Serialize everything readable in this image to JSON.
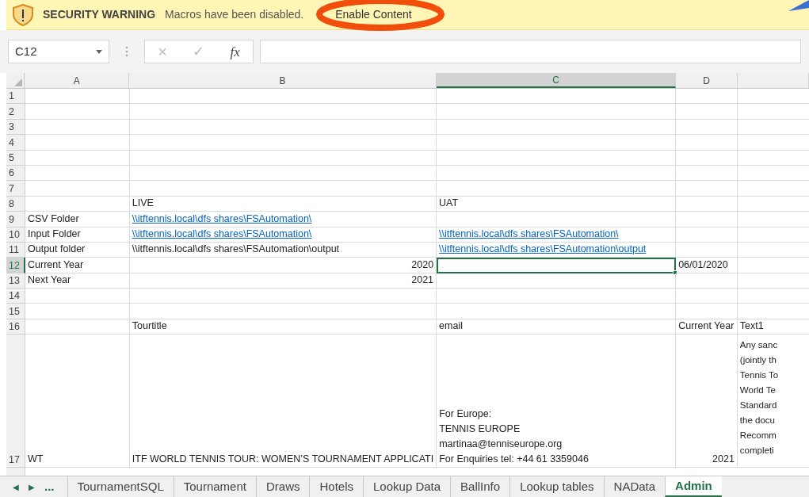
{
  "security_bar": {
    "title": "SECURITY WARNING",
    "message": "Macros have been disabled.",
    "button": "Enable Content"
  },
  "formula_bar": {
    "name_box": "C12",
    "buttons": [
      "×",
      "✓",
      "fx"
    ]
  },
  "columns": [
    {
      "label": "A",
      "selected": false
    },
    {
      "label": "B",
      "selected": false
    },
    {
      "label": "C",
      "selected": true
    },
    {
      "label": "D",
      "selected": false
    },
    {
      "selected": false
    }
  ],
  "rows": [
    {
      "number": "1",
      "selected": false,
      "cells": [
        null,
        null,
        null,
        null,
        null
      ]
    },
    {
      "number": "2",
      "selected": false,
      "cells": [
        null,
        null,
        null,
        null,
        null
      ]
    },
    {
      "number": "3",
      "selected": false,
      "cells": [
        null,
        null,
        null,
        null,
        null
      ]
    },
    {
      "number": "4",
      "selected": false,
      "cells": [
        null,
        null,
        null,
        null,
        null
      ]
    },
    {
      "number": "5",
      "selected": false,
      "cells": [
        null,
        null,
        null,
        null,
        null
      ]
    },
    {
      "number": "6",
      "selected": false,
      "cells": [
        null,
        null,
        null,
        null,
        null
      ]
    },
    {
      "number": "7",
      "selected": false,
      "cells": [
        null,
        null,
        null,
        null,
        null
      ]
    },
    {
      "number": "8",
      "selected": false,
      "cells": [
        null,
        {
          "kind": "text",
          "lines": [
            "LIVE"
          ]
        },
        {
          "kind": "text",
          "lines": [
            "UAT"
          ]
        },
        null,
        null
      ]
    },
    {
      "number": "9",
      "selected": false,
      "cells": [
        {
          "kind": "text",
          "lines": [
            "CSV Folder"
          ]
        },
        {
          "kind": "link",
          "lines": [
            "\\\\itftennis.local\\dfs shares\\FSAutomation\\"
          ]
        },
        null,
        null,
        null
      ]
    },
    {
      "number": "10",
      "selected": false,
      "cells": [
        {
          "kind": "text",
          "lines": [
            "Input Folder"
          ]
        },
        {
          "kind": "link",
          "lines": [
            "\\\\itftennis.local\\dfs shares\\FSAutomation\\"
          ]
        },
        {
          "kind": "link",
          "lines": [
            "\\\\itftennis.local\\dfs shares\\FSAutomation\\"
          ]
        },
        null,
        null
      ]
    },
    {
      "number": "11",
      "selected": false,
      "cells": [
        {
          "kind": "text",
          "lines": [
            "Output folder"
          ]
        },
        {
          "kind": "text",
          "lines": [
            "\\\\itftennis.local\\dfs shares\\FSAutomation\\output"
          ]
        },
        {
          "kind": "link",
          "lines": [
            "\\\\itftennis.local\\dfs shares\\FSAutomation\\output"
          ]
        },
        null,
        null
      ]
    },
    {
      "number": "12",
      "selected": true,
      "cells": [
        {
          "kind": "text",
          "lines": [
            "Current Year"
          ]
        },
        {
          "kind": "number",
          "lines": [
            "2020"
          ]
        },
        {
          "kind": "active"
        },
        {
          "kind": "text",
          "lines": [
            "06/01/2020"
          ]
        },
        null
      ]
    },
    {
      "number": "13",
      "selected": false,
      "cells": [
        {
          "kind": "text",
          "lines": [
            "Next Year"
          ]
        },
        {
          "kind": "number",
          "lines": [
            "2021"
          ]
        },
        null,
        null,
        null
      ]
    },
    {
      "number": "14",
      "selected": false,
      "cells": [
        null,
        null,
        null,
        null,
        null
      ]
    },
    {
      "number": "15",
      "selected": false,
      "cells": [
        null,
        null,
        null,
        null,
        null
      ]
    },
    {
      "number": "16",
      "selected": false,
      "cells": [
        null,
        {
          "kind": "text",
          "lines": [
            "Tourtitle"
          ]
        },
        {
          "kind": "text",
          "lines": [
            "email"
          ]
        },
        {
          "kind": "text",
          "lines": [
            "Current Year"
          ]
        },
        {
          "kind": "text",
          "lines": [
            "Text1"
          ]
        }
      ]
    },
    {
      "number": "17",
      "selected": false,
      "cells": [
        {
          "kind": "text",
          "lines": [
            "WT"
          ]
        },
        {
          "kind": "text",
          "lines": [
            "ITF WORLD TENNIS TOUR: WOMEN’S TOURNAMENT APPLICATI"
          ]
        },
        {
          "kind": "text",
          "lines": [
            "For Europe:",
            "TENNIS EUROPE",
            "martinaa@tenniseurope.org",
            "For Enquiries tel: +44 61 3359046"
          ]
        },
        {
          "kind": "number",
          "lines": [
            "2021"
          ]
        },
        {
          "kind": "text",
          "lines": [
            "Any sanc",
            "(jointly th",
            "Tennis To",
            "World Te",
            "Standard",
            "the docu",
            "Recomm",
            "completi"
          ]
        }
      ]
    }
  ],
  "sheet_nav": [
    "◀",
    "▶",
    "..."
  ],
  "sheets": [
    {
      "name": "TournamentSQL",
      "selected": false
    },
    {
      "name": "Tournament",
      "selected": false
    },
    {
      "name": "Draws",
      "selected": false
    },
    {
      "name": "Hotels",
      "selected": false
    },
    {
      "name": "Lookup Data",
      "selected": false
    },
    {
      "name": "BallInfo",
      "selected": false
    },
    {
      "name": "Lookup tables",
      "selected": false
    },
    {
      "name": "NAData",
      "selected": false
    },
    {
      "name": "Admin",
      "selected": true
    }
  ]
}
